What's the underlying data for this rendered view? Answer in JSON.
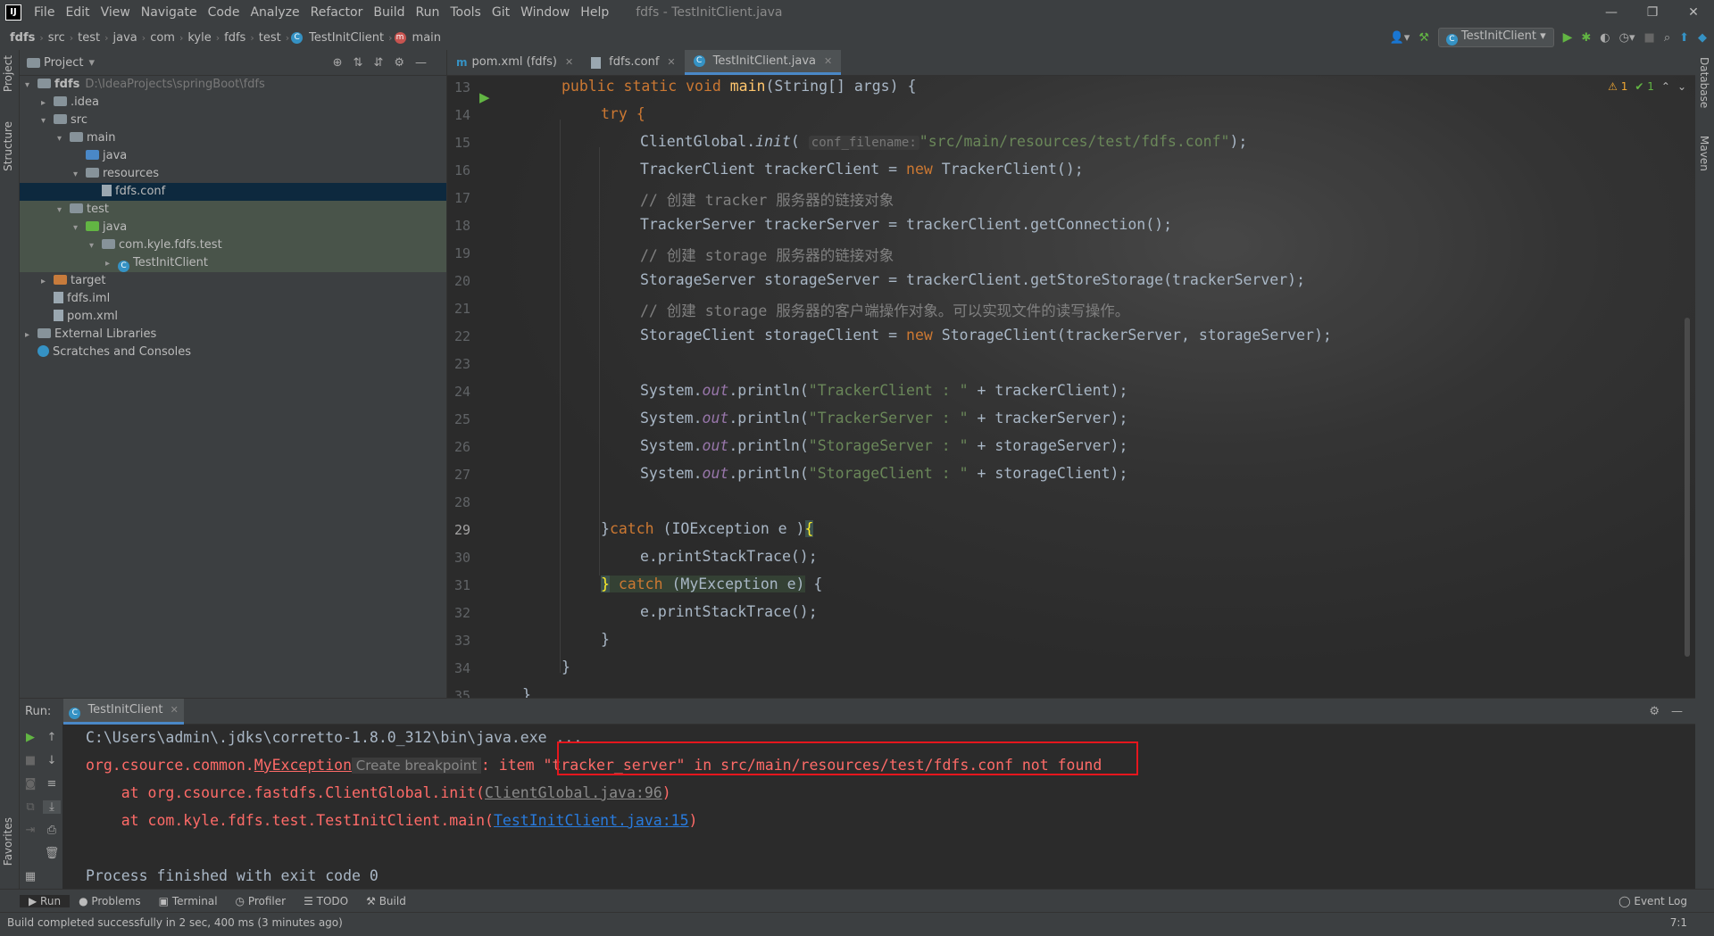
{
  "window": {
    "title": "fdfs - TestInitClient.java",
    "menu": [
      "File",
      "Edit",
      "View",
      "Navigate",
      "Code",
      "Analyze",
      "Refactor",
      "Build",
      "Run",
      "Tools",
      "Git",
      "Window",
      "Help"
    ],
    "controls": [
      "—",
      "❐",
      "✕"
    ]
  },
  "breadcrumb": [
    "fdfs",
    "src",
    "test",
    "java",
    "com",
    "kyle",
    "fdfs",
    "test",
    "TestInitClient",
    "main"
  ],
  "run_config": "TestInitClient",
  "project": {
    "header": "Project",
    "tree": [
      {
        "label": "fdfs",
        "path": "D:\\IdeaProjects\\springBoot\\fdfs",
        "depth": 0,
        "arrow": "▾",
        "icon": "folder-gray"
      },
      {
        "label": ".idea",
        "depth": 1,
        "arrow": "▸",
        "icon": "folder-gray"
      },
      {
        "label": "src",
        "depth": 1,
        "arrow": "▾",
        "icon": "folder-gray"
      },
      {
        "label": "main",
        "depth": 2,
        "arrow": "▾",
        "icon": "folder-gray"
      },
      {
        "label": "java",
        "depth": 3,
        "arrow": "",
        "icon": "folder-blue"
      },
      {
        "label": "resources",
        "depth": 3,
        "arrow": "▾",
        "icon": "folder-gray"
      },
      {
        "label": "fdfs.conf",
        "depth": 4,
        "arrow": "",
        "icon": "file",
        "selected": true
      },
      {
        "label": "test",
        "depth": 2,
        "arrow": "▾",
        "icon": "folder-gray",
        "test": true
      },
      {
        "label": "java",
        "depth": 3,
        "arrow": "▾",
        "icon": "folder-green",
        "test": true
      },
      {
        "label": "com.kyle.fdfs.test",
        "depth": 4,
        "arrow": "▾",
        "icon": "folder-gray",
        "test": true
      },
      {
        "label": "TestInitClient",
        "depth": 5,
        "arrow": "▸",
        "icon": "class",
        "test": true
      },
      {
        "label": "target",
        "depth": 1,
        "arrow": "▸",
        "icon": "folder-orange"
      },
      {
        "label": "fdfs.iml",
        "depth": 1,
        "arrow": "",
        "icon": "file"
      },
      {
        "label": "pom.xml",
        "depth": 1,
        "arrow": "",
        "icon": "file"
      },
      {
        "label": "External Libraries",
        "depth": 0,
        "arrow": "▸",
        "icon": "library"
      },
      {
        "label": "Scratches and Consoles",
        "depth": 0,
        "arrow": "",
        "icon": "scratch"
      }
    ]
  },
  "left_strip": [
    "Project",
    "Structure",
    "Favorites"
  ],
  "right_strip": [
    "Database",
    "Maven"
  ],
  "tabs": [
    {
      "label": "pom.xml (fdfs)",
      "icon": "m"
    },
    {
      "label": "fdfs.conf",
      "icon": "file"
    },
    {
      "label": "TestInitClient.java",
      "icon": "class",
      "active": true
    }
  ],
  "inspections": {
    "warnings": "⚠ 1",
    "ok": "✔ 1"
  },
  "line_numbers": [
    "13",
    "14",
    "15",
    "16",
    "17",
    "18",
    "19",
    "20",
    "21",
    "22",
    "23",
    "24",
    "25",
    "26",
    "27",
    "28",
    "29",
    "30",
    "31",
    "32",
    "33",
    "34",
    "35"
  ],
  "code": {
    "l13": [
      "public static void ",
      "main",
      "(String[] args) {"
    ],
    "l14": [
      "try {"
    ],
    "l15": [
      "ClientGlobal.",
      "init",
      "( ",
      "conf_filename:",
      "\"src/main/resources/test/fdfs.conf\"",
      ");"
    ],
    "l16": [
      "TrackerClient trackerClient = ",
      "new ",
      "TrackerClient();"
    ],
    "l17": [
      "// 创建 tracker 服务器的链接对象"
    ],
    "l18": [
      "TrackerServer trackerServer = trackerClient.getConnection();"
    ],
    "l19": [
      "// 创建 storage 服务器的链接对象"
    ],
    "l20": [
      "StorageServer storageServer = trackerClient.getStoreStorage(trackerServer);"
    ],
    "l21": [
      "// 创建 storage 服务器的客户端操作对象。可以实现文件的读写操作。"
    ],
    "l22": [
      "StorageClient storageClient = ",
      "new ",
      "StorageClient(trackerServer, storageServer);"
    ],
    "l24": [
      "System.",
      "out",
      ".println(",
      "\"TrackerClient : \"",
      " + trackerClient);"
    ],
    "l25": [
      "System.",
      "out",
      ".println(",
      "\"TrackerServer : \"",
      " + trackerServer);"
    ],
    "l26": [
      "System.",
      "out",
      ".println(",
      "\"StorageServer : \"",
      " + storageServer);"
    ],
    "l27": [
      "System.",
      "out",
      ".println(",
      "\"StorageClient : \"",
      " + storageClient);"
    ],
    "l29": [
      "}",
      "catch ",
      "(IOException e )",
      "{"
    ],
    "l30": [
      "e.printStackTrace();"
    ],
    "l31": [
      "}",
      " catch ",
      "(MyException e)",
      " {"
    ],
    "l32": [
      "e.printStackTrace();"
    ],
    "l33": [
      "}"
    ],
    "l34": [
      "}"
    ],
    "l35": [
      "}"
    ]
  },
  "run": {
    "label": "Run:",
    "tab": "TestInitClient",
    "console": {
      "c1": "C:\\Users\\admin\\.jdks\\corretto-1.8.0_312\\bin\\java.exe ...",
      "c2_pre": "org.csource.common.",
      "c2_link": "MyException",
      "c2_hint": " Create breakpoint ",
      "c2_msg": ": item \"tracker_server\" in src/main/resources/test/fdfs.conf not found",
      "c3_pre": "    at org.csource.fastdfs.ClientGlobal.init(",
      "c3_link": "ClientGlobal.java:96",
      "c3_post": ")",
      "c4_pre": "    at com.kyle.fdfs.test.TestInitClient.main(",
      "c4_link": "TestInitClient.java:15",
      "c4_post": ")",
      "c5": "Process finished with exit code 0"
    }
  },
  "bottom_tabs": [
    {
      "label": "▶ Run",
      "active": true
    },
    {
      "label": "● Problems"
    },
    {
      "label": "▣ Terminal"
    },
    {
      "label": "◷ Profiler"
    },
    {
      "label": "☰ TODO"
    },
    {
      "label": "⚒ Build"
    }
  ],
  "event_log": "Event Log",
  "status": {
    "text": "Build completed successfully in 2 sec, 400 ms (3 minutes ago)",
    "position": "7:1"
  }
}
